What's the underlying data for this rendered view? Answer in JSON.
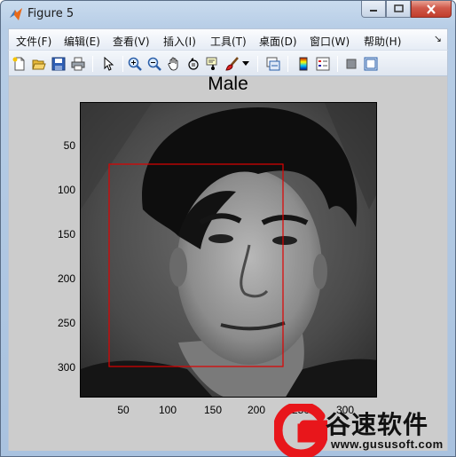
{
  "window": {
    "title": "Figure 5"
  },
  "menu": {
    "items": [
      "文件(F)",
      "编辑(E)",
      "查看(V)",
      "插入(I)",
      "工具(T)",
      "桌面(D)",
      "窗口(W)",
      "帮助(H)"
    ],
    "more": "↘"
  },
  "toolbar": {
    "icons": [
      "new-figure-icon",
      "open-file-icon",
      "save-icon",
      "print-icon",
      "edit-plot-arrow-icon",
      "zoom-in-icon",
      "zoom-out-icon",
      "pan-hand-icon",
      "rotate-3d-icon",
      "data-cursor-icon",
      "brush-icon",
      "dropdown-arrow-icon",
      "link-plot-icon",
      "colorbar-icon",
      "legend-icon",
      "hide-plot-tools-icon",
      "show-plot-tools-icon"
    ]
  },
  "figure": {
    "title": "Male",
    "y_ticks": [
      "50",
      "100",
      "150",
      "200",
      "250",
      "300"
    ],
    "x_ticks": [
      "50",
      "100",
      "150",
      "200",
      "250",
      "300"
    ],
    "bounding_box_color": "#e00000"
  },
  "watermark": {
    "brand": "谷速软件",
    "url": "www.gususoft.com",
    "color": "#e8161b"
  }
}
